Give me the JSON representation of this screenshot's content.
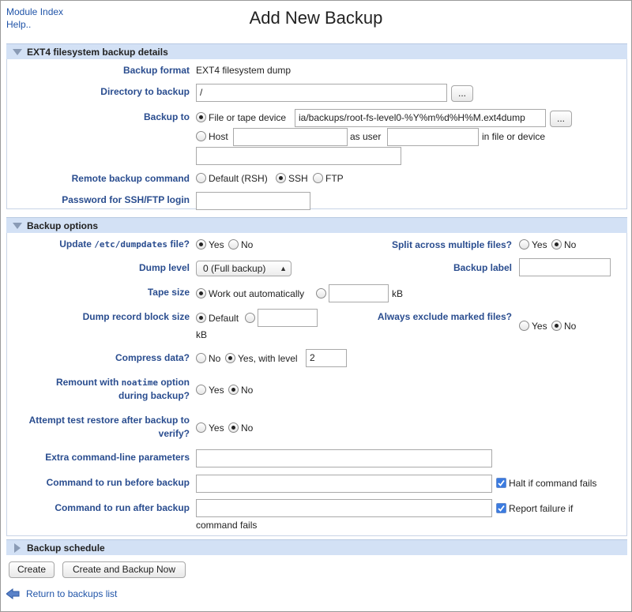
{
  "header": {
    "module_index": "Module Index",
    "help": "Help..",
    "title": "Add New Backup"
  },
  "sections": {
    "details": "EXT4 filesystem backup details",
    "options": "Backup options",
    "schedule": "Backup schedule"
  },
  "details": {
    "format_label": "Backup format",
    "format_value": "EXT4 filesystem dump",
    "directory_label": "Directory to backup",
    "directory_value": "/",
    "browse": "...",
    "backup_to_label": "Backup to",
    "file_option": "File or tape device",
    "file_value": "ia/backups/root-fs-level0-%Y%m%d%H%M.ext4dump",
    "host_option": "Host",
    "as_user": "as user",
    "in_file": "in file or device",
    "remote_label": "Remote backup command",
    "remote_default": "Default (RSH)",
    "remote_ssh": "SSH",
    "remote_ftp": "FTP",
    "password_label": "Password for SSH/FTP login"
  },
  "options": {
    "update_label_pre": "Update",
    "update_label_code": "/etc/dumpdates",
    "update_label_post": "file?",
    "yes": "Yes",
    "no": "No",
    "split_label": "Split across multiple files?",
    "dump_level_label": "Dump level",
    "dump_level_value": "0 (Full backup)",
    "backup_label_label": "Backup label",
    "tape_size_label": "Tape size",
    "work_out": "Work out automatically",
    "kb": "kB",
    "record_block_label": "Dump record block size",
    "default": "Default",
    "exclude_label": "Always exclude marked files?",
    "compress_label": "Compress data?",
    "yes_with_level": "Yes, with level",
    "compress_level": "2",
    "remount_pre": "Remount with",
    "remount_code": "noatime",
    "remount_post": "option",
    "remount_line2": "during backup?",
    "test_restore_line1": "Attempt test restore after backup to",
    "test_restore_line2": "verify?",
    "extra_params_label": "Extra command-line parameters",
    "before_label": "Command to run before backup",
    "halt_if_fails": "Halt if command fails",
    "after_label": "Command to run after backup",
    "report_failure": "Report failure if",
    "command_fails": "command fails"
  },
  "actions": {
    "create": "Create",
    "create_and_backup": "Create and Backup Now",
    "return_link": "Return to backups list"
  },
  "colors": {
    "label_blue": "#2a4d8f",
    "link_blue": "#2054a8",
    "section_bg": "#d3e1f5"
  }
}
